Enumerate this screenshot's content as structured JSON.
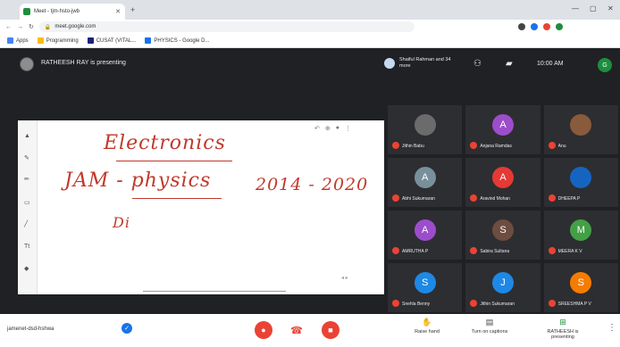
{
  "browser": {
    "tab_title": "Meet - tjm-hsto-jwb",
    "address": "meet.google.com",
    "bookmarks": [
      {
        "label": "Apps"
      },
      {
        "label": "Programming"
      },
      {
        "label": "CUSAT (VITAL..."
      },
      {
        "label": "PHYSICS - Google D..."
      }
    ]
  },
  "meet_top": {
    "presenter_label": "RATHEESH RAY is presenting",
    "others_label": "Shaiful Rahman and 34 more",
    "time": "10:00 AM",
    "me_initial": "G"
  },
  "board": {
    "line1": "Electronics",
    "line2": "JAM - physics",
    "line3": "2014 - 2020",
    "line4": "Di"
  },
  "participants": [
    {
      "name": "Jithin Babu",
      "initial": "",
      "color": "#6b6b6b"
    },
    {
      "name": "Anjana Ramdas",
      "initial": "A",
      "color": "#9c4dcc"
    },
    {
      "name": "Anu",
      "initial": "",
      "color": "#8a5a3c"
    },
    {
      "name": "Abhi Sukumaran",
      "initial": "A",
      "color": "#78909c"
    },
    {
      "name": "Aravind Mohan",
      "initial": "A",
      "color": "#e53935"
    },
    {
      "name": "DHEEPA P",
      "initial": "",
      "color": "#1565c0"
    },
    {
      "name": "AMRUTHA P",
      "initial": "A",
      "color": "#9c4dcc"
    },
    {
      "name": "Sabira Sultana",
      "initial": "S",
      "color": "#6d4c41"
    },
    {
      "name": "MEERA K V",
      "initial": "M",
      "color": "#43a047"
    },
    {
      "name": "Snehla Benny",
      "initial": "S",
      "color": "#1e88e5"
    },
    {
      "name": "Jithin Sukumaran",
      "initial": "J",
      "color": "#1e88e5"
    },
    {
      "name": "SREESHMA P V",
      "initial": "S",
      "color": "#f57c00"
    }
  ],
  "bottom": {
    "meeting_code": "jamenet-dsd-hshwa",
    "raise_hand": "Raise hand",
    "captions": "Turn on captions",
    "present": "RATHEESH is presenting"
  }
}
